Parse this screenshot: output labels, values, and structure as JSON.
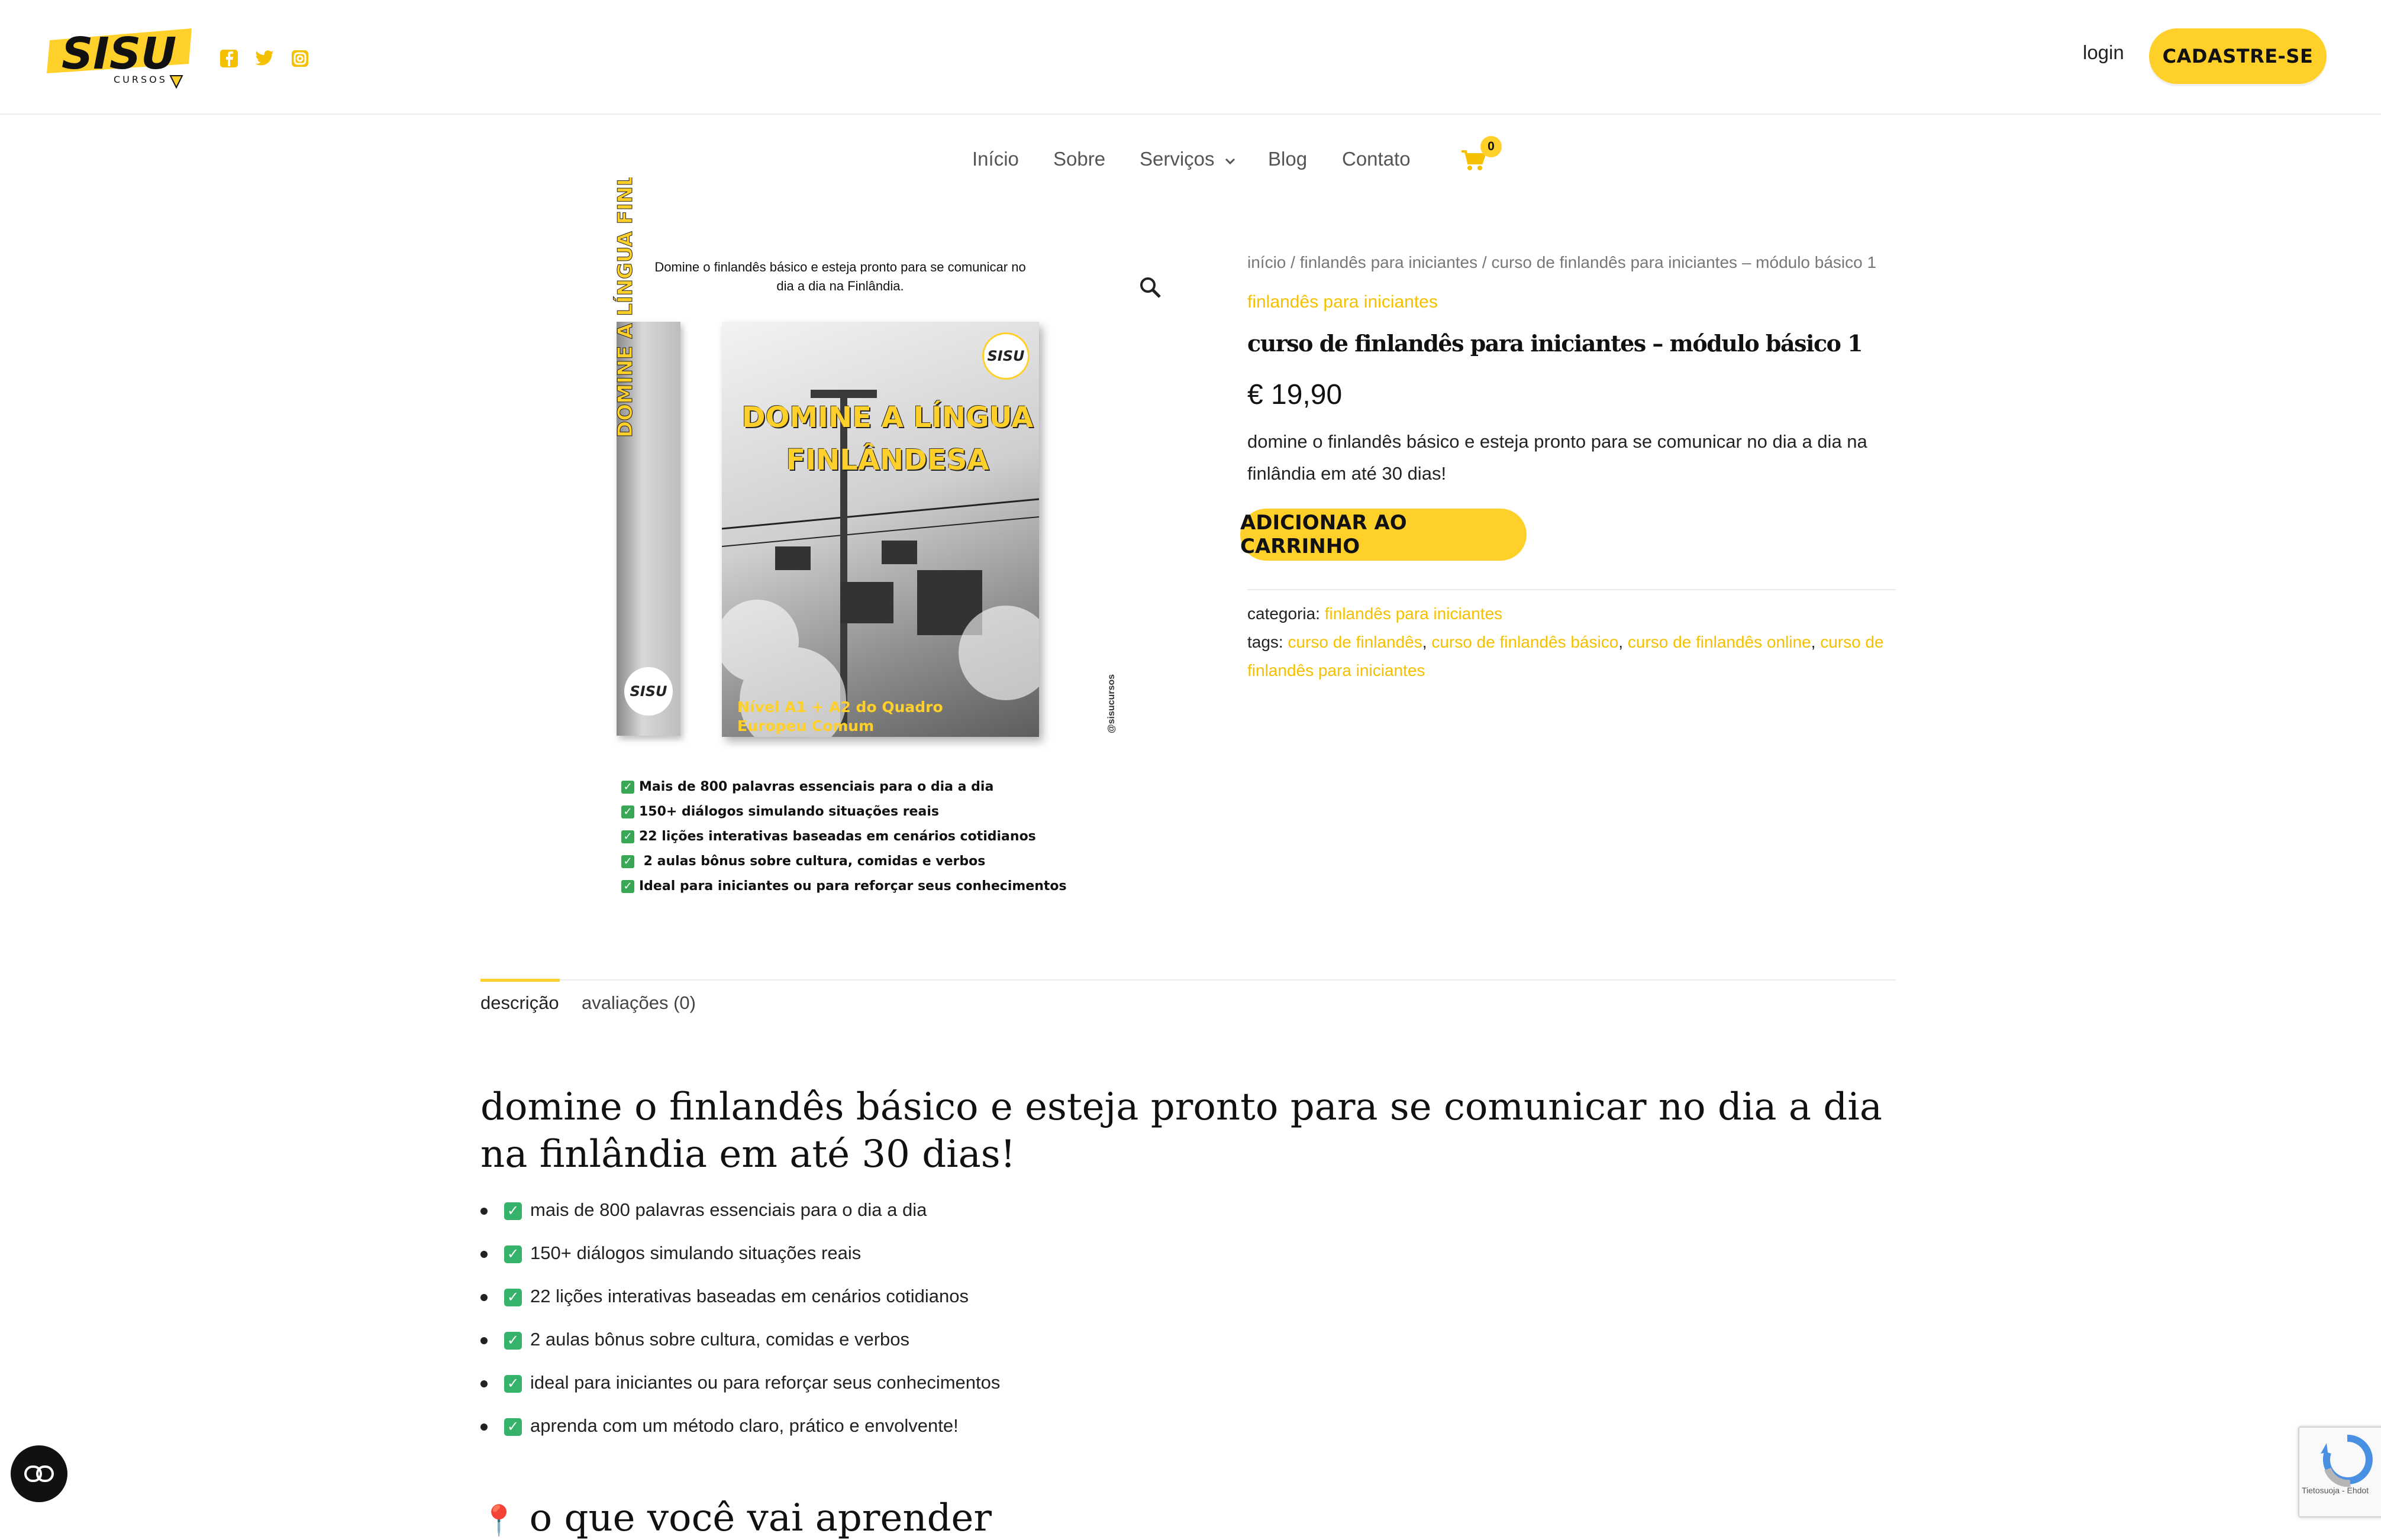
{
  "header": {
    "logo_text": "SISU",
    "logo_subtext": "CURSOS",
    "social": [
      "facebook-icon",
      "twitter-icon",
      "instagram-icon"
    ],
    "login_label": "login",
    "signup_label": "CADASTRE-SE"
  },
  "nav": {
    "items": [
      "Início",
      "Sobre",
      "Serviços",
      "Blog",
      "Contato"
    ],
    "cart_count": "0"
  },
  "gallery": {
    "tagline": "Domine o finlandês básico e esteja pronto para se comunicar no dia a dia na Finlândia.",
    "cover_title": "DOMINE A LÍNGUA FINLÂNDESA",
    "spine_title": "DOMINE A LÍNGUA FINLÂNDESA",
    "cover_level": "Nível A1 + A2 do Quadro Europeu Comum",
    "badge": "SISU",
    "watermark": "@sisucursos",
    "bullets": [
      "Mais de 800 palavras essenciais para o dia a dia",
      "150+ diálogos simulando situações reais",
      "22 lições interativas baseadas em cenários cotidianos",
      " 2 aulas bônus sobre cultura, comidas e verbos",
      "Ideal para iniciantes ou para reforçar seus conhecimentos"
    ]
  },
  "product": {
    "breadcrumb": "início / finlandês para iniciantes / curso de finlandês para iniciantes – módulo básico 1",
    "category_link": "finlandês para iniciantes",
    "title": "curso de finlandês para iniciantes – módulo básico 1",
    "price": "€ 19,90",
    "short_description": "domine o finlandês básico e esteja pronto para se comunicar no dia a dia na finlândia em até 30 dias!",
    "add_to_cart_label": "ADICIONAR AO CARRINHO",
    "category_label": "categoria:",
    "category_value": "finlandês para iniciantes",
    "tags_label": "tags:",
    "tags": [
      "curso de finlandês",
      "curso de finlandês básico",
      "curso de finlandês online",
      "curso de finlandês para iniciantes"
    ]
  },
  "tabs": {
    "description": "descrição",
    "reviews": "avaliações (0)"
  },
  "description": {
    "heading": "domine o finlandês básico e esteja pronto para se comunicar no dia a dia na finlândia em até 30 dias!",
    "items": [
      "mais de 800 palavras essenciais para o dia a dia",
      "150+ diálogos simulando situações reais",
      "22 lições interativas baseadas em cenários cotidianos",
      "2 aulas bônus sobre cultura, comidas e verbos",
      "ideal para iniciantes ou para reforçar seus conhecimentos",
      "aprenda com um método claro, prático e envolvente!"
    ],
    "next_heading_partial": "o que você vai aprender"
  },
  "recaptcha": {
    "text": "Tietosuoja - Ehdot"
  },
  "colors": {
    "accent": "#ffd02a",
    "link": "#f5c000"
  }
}
